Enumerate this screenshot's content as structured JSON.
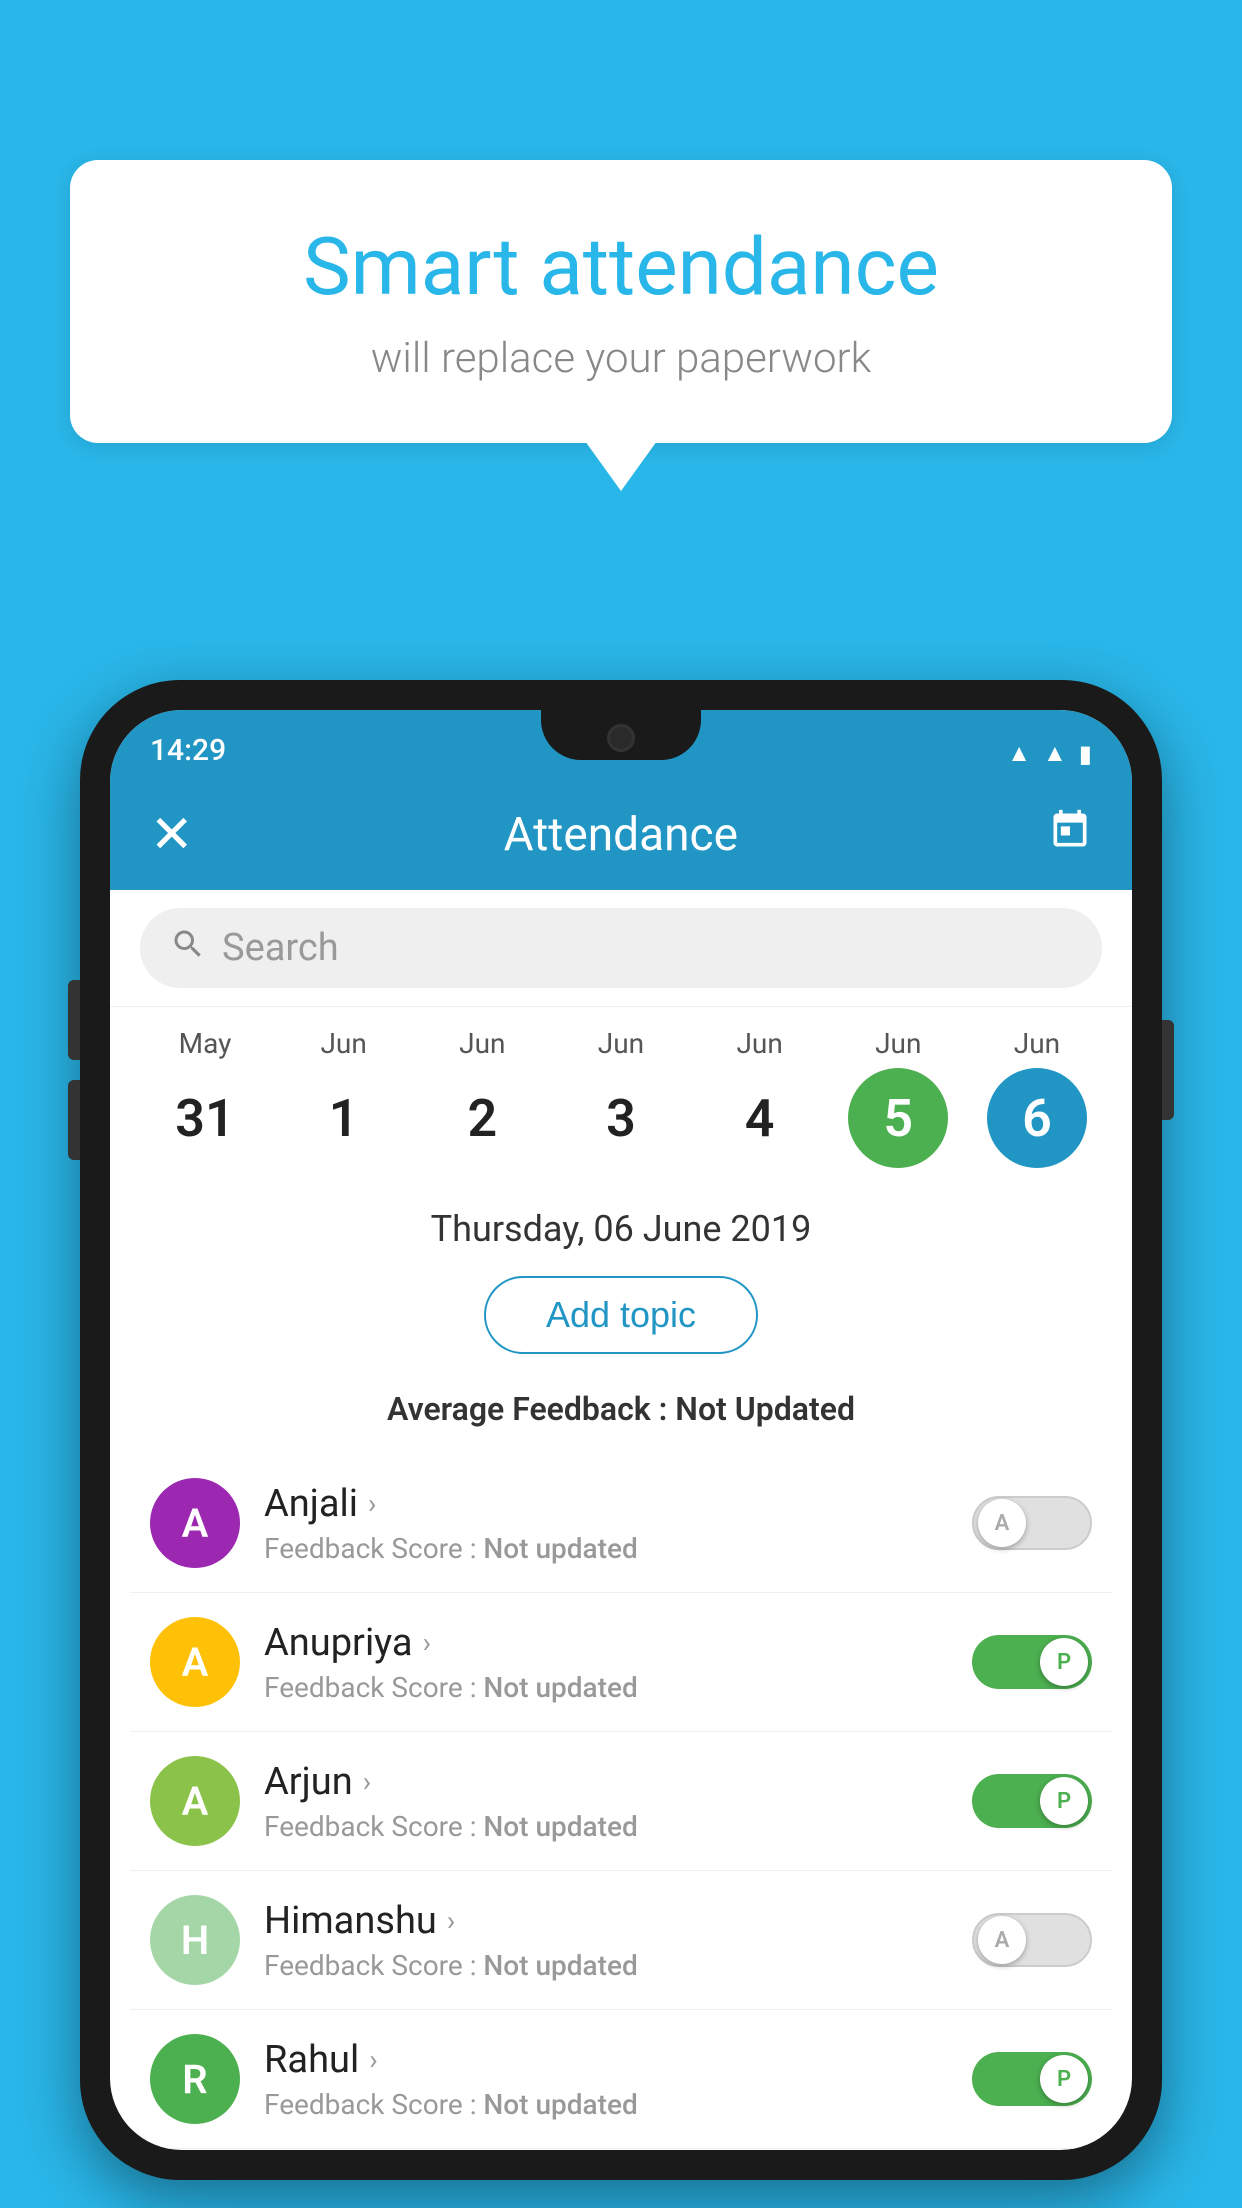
{
  "background_color": "#29b6e8",
  "speech_bubble": {
    "title": "Smart attendance",
    "subtitle": "will replace your paperwork"
  },
  "status_bar": {
    "time": "14:29",
    "wifi_icon": "▲",
    "signal_icon": "▲",
    "battery_icon": "▮"
  },
  "app_bar": {
    "title": "Attendance",
    "close_label": "✕",
    "calendar_icon": "📅"
  },
  "search": {
    "placeholder": "Search"
  },
  "calendar": {
    "dates": [
      {
        "month": "May",
        "day": "31",
        "state": "normal"
      },
      {
        "month": "Jun",
        "day": "1",
        "state": "normal"
      },
      {
        "month": "Jun",
        "day": "2",
        "state": "normal"
      },
      {
        "month": "Jun",
        "day": "3",
        "state": "normal"
      },
      {
        "month": "Jun",
        "day": "4",
        "state": "normal"
      },
      {
        "month": "Jun",
        "day": "5",
        "state": "today"
      },
      {
        "month": "Jun",
        "day": "6",
        "state": "selected"
      }
    ],
    "selected_date_full": "Thursday, 06 June 2019",
    "add_topic_label": "Add topic",
    "avg_feedback_label": "Average Feedback :",
    "avg_feedback_value": "Not Updated"
  },
  "students": [
    {
      "name": "Anjali",
      "avatar_letter": "A",
      "avatar_color": "#9c27b0",
      "score_label": "Feedback Score :",
      "score_value": "Not updated",
      "attendance": "A",
      "toggle_state": "off"
    },
    {
      "name": "Anupriya",
      "avatar_letter": "A",
      "avatar_color": "#ffc107",
      "score_label": "Feedback Score :",
      "score_value": "Not updated",
      "attendance": "P",
      "toggle_state": "on"
    },
    {
      "name": "Arjun",
      "avatar_letter": "A",
      "avatar_color": "#8bc34a",
      "score_label": "Feedback Score :",
      "score_value": "Not updated",
      "attendance": "P",
      "toggle_state": "on"
    },
    {
      "name": "Himanshu",
      "avatar_letter": "H",
      "avatar_color": "#a5d6a7",
      "score_label": "Feedback Score :",
      "score_value": "Not updated",
      "attendance": "A",
      "toggle_state": "off"
    },
    {
      "name": "Rahul",
      "avatar_letter": "R",
      "avatar_color": "#4caf50",
      "score_label": "Feedback Score :",
      "score_value": "Not updated",
      "attendance": "P",
      "toggle_state": "on"
    }
  ]
}
